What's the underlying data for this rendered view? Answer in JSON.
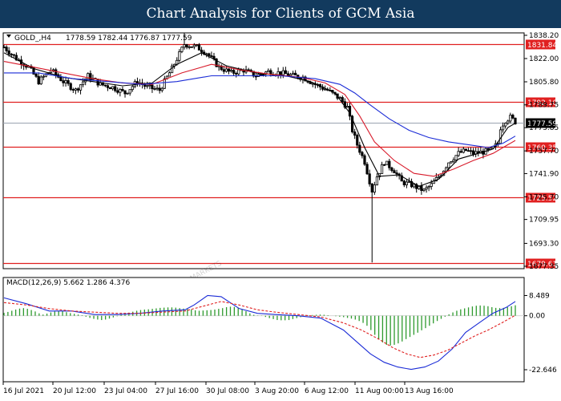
{
  "header": {
    "title": "Chart Analysis for Clients of GCM Asia"
  },
  "watermark": {
    "main": "GCMASIA",
    "sub": "GLOBAL CAPITAL MARKETS",
    "opacity": 0.18
  },
  "colors": {
    "header_bg": "#123a5e",
    "candle": "#000000",
    "ma_fast": "#000000",
    "ma_mid": "#d81b2b",
    "ma_slow": "#1a2bd6",
    "level_line": "#e02020",
    "macd_hist": "#2e9a2e",
    "macd_line": "#1a2bd6",
    "signal_line": "#e02020",
    "last_price_line": "#9aa3b0"
  },
  "chart_data": [
    {
      "type": "candlestick",
      "symbol_label": "GOLD_,H4",
      "ohlc_label": "1778.59 1782.44 1776.87 1777.59",
      "y_ticks": [
        "1838.20",
        "1822.00",
        "1805.80",
        "1789.75",
        "1773.85",
        "1757.70",
        "1741.90",
        "1725.70",
        "1709.95",
        "1693.30",
        "1677.35"
      ],
      "y_range": [
        1677.35,
        1838.2
      ],
      "x_labels": [
        "16 Jul 2021",
        "20 Jul 12:00",
        "23 Jul 04:00",
        "27 Jul 16:00",
        "30 Jul 08:00",
        "3 Aug 20:00",
        "6 Aug 12:00",
        "11 Aug 00:00",
        "13 Aug 16:00"
      ],
      "levels": [
        {
          "label": "1831.84",
          "value": 1831.84
        },
        {
          "label": "1792.10",
          "value": 1792.1
        },
        {
          "label": "1760.35",
          "value": 1760.35
        },
        {
          "label": "1725.52",
          "value": 1725.52
        },
        {
          "label": "1679.61",
          "value": 1679.61
        }
      ],
      "last_price": {
        "label": "1777.59",
        "value": 1777.59
      },
      "close_path": [
        [
          0,
          1830
        ],
        [
          5,
          1822
        ],
        [
          10,
          1816
        ],
        [
          14,
          1806
        ],
        [
          19,
          1814
        ],
        [
          24,
          1806
        ],
        [
          29,
          1800
        ],
        [
          34,
          1810
        ],
        [
          39,
          1804
        ],
        [
          44,
          1802
        ],
        [
          49,
          1798
        ],
        [
          54,
          1806
        ],
        [
          58,
          1802
        ],
        [
          63,
          1800
        ],
        [
          68,
          1815
        ],
        [
          73,
          1832
        ],
        [
          78,
          1830
        ],
        [
          82,
          1826
        ],
        [
          87,
          1816
        ],
        [
          92,
          1812
        ],
        [
          97,
          1814
        ],
        [
          102,
          1810
        ],
        [
          107,
          1813
        ],
        [
          112,
          1812
        ],
        [
          117,
          1810
        ],
        [
          121,
          1809
        ],
        [
          126,
          1804
        ],
        [
          131,
          1800
        ],
        [
          136,
          1794
        ],
        [
          139,
          1788
        ],
        [
          141,
          1772
        ],
        [
          143,
          1762
        ],
        [
          146,
          1750
        ],
        [
          149,
          1730
        ],
        [
          151,
          1740
        ],
        [
          154,
          1750
        ],
        [
          158,
          1744
        ],
        [
          161,
          1736
        ],
        [
          165,
          1734
        ],
        [
          170,
          1730
        ],
        [
          173,
          1734
        ],
        [
          177,
          1742
        ],
        [
          180,
          1750
        ],
        [
          184,
          1756
        ],
        [
          187,
          1758
        ],
        [
          190,
          1756
        ],
        [
          194,
          1757
        ],
        [
          197,
          1758
        ],
        [
          200,
          1763
        ],
        [
          201,
          1774
        ],
        [
          203,
          1779
        ],
        [
          205,
          1781
        ],
        [
          207,
          1778
        ]
      ],
      "moving_averages": [
        {
          "name": "fast",
          "color": "#000000",
          "points": [
            [
              0,
              1826
            ],
            [
              12,
              1815
            ],
            [
              24,
              1809
            ],
            [
              36,
              1806
            ],
            [
              48,
              1803
            ],
            [
              60,
              1805
            ],
            [
              70,
              1818
            ],
            [
              80,
              1826
            ],
            [
              90,
              1817
            ],
            [
              102,
              1812
            ],
            [
              114,
              1810
            ],
            [
              124,
              1806
            ],
            [
              134,
              1798
            ],
            [
              140,
              1784
            ],
            [
              146,
              1760
            ],
            [
              152,
              1740
            ],
            [
              160,
              1741
            ],
            [
              168,
              1733
            ],
            [
              176,
              1738
            ],
            [
              184,
              1752
            ],
            [
              192,
              1756
            ],
            [
              198,
              1759
            ],
            [
              204,
              1774
            ],
            [
              207,
              1777
            ]
          ]
        },
        {
          "name": "mid",
          "color": "#d81b2b",
          "points": [
            [
              0,
              1820
            ],
            [
              12,
              1816
            ],
            [
              24,
              1812
            ],
            [
              36,
              1808
            ],
            [
              48,
              1805
            ],
            [
              60,
              1804
            ],
            [
              72,
              1812
            ],
            [
              84,
              1818
            ],
            [
              96,
              1814
            ],
            [
              108,
              1811
            ],
            [
              120,
              1809
            ],
            [
              130,
              1805
            ],
            [
              138,
              1797
            ],
            [
              144,
              1782
            ],
            [
              150,
              1764
            ],
            [
              158,
              1751
            ],
            [
              166,
              1742
            ],
            [
              174,
              1740
            ],
            [
              182,
              1745
            ],
            [
              190,
              1751
            ],
            [
              198,
              1756
            ],
            [
              204,
              1762
            ],
            [
              207,
              1765
            ]
          ]
        },
        {
          "name": "slow",
          "color": "#1a2bd6",
          "points": [
            [
              0,
              1812
            ],
            [
              14,
              1812
            ],
            [
              28,
              1808
            ],
            [
              42,
              1806
            ],
            [
              56,
              1804
            ],
            [
              70,
              1806
            ],
            [
              84,
              1810
            ],
            [
              98,
              1810
            ],
            [
              112,
              1810
            ],
            [
              126,
              1808
            ],
            [
              136,
              1804
            ],
            [
              142,
              1798
            ],
            [
              148,
              1790
            ],
            [
              156,
              1780
            ],
            [
              164,
              1772
            ],
            [
              172,
              1767
            ],
            [
              180,
              1764
            ],
            [
              188,
              1762
            ],
            [
              196,
              1760
            ],
            [
              202,
              1763
            ],
            [
              207,
              1768
            ]
          ]
        }
      ]
    },
    {
      "type": "macd",
      "label": "MACD(12,26,9) 5.662 1.286 4.376",
      "y_ticks": [
        "8.489",
        "0.00",
        "-22.646"
      ],
      "y_range": [
        -25.0,
        11.0
      ],
      "histogram": [
        1.2,
        1.6,
        2.1,
        2.6,
        3.0,
        3.2,
        2.9,
        2.4,
        1.8,
        1.0,
        0.5,
        0.9,
        1.4,
        1.8,
        2.0,
        1.9,
        1.5,
        1.1,
        0.8,
        0.5,
        0.2,
        -0.4,
        -0.9,
        -1.3,
        -1.6,
        -1.8,
        -1.6,
        -1.2,
        -0.7,
        -0.2,
        0.4,
        0.9,
        1.3,
        1.7,
        2.1,
        2.4,
        2.6,
        2.7,
        2.9,
        3.1,
        3.3,
        3.4,
        3.5,
        3.5,
        3.4,
        3.2,
        3.0,
        2.8,
        2.6,
        2.3,
        2.1,
        2.2,
        2.3,
        2.4,
        2.6,
        2.9,
        3.2,
        3.6,
        3.8,
        3.7,
        3.4,
        2.8,
        1.9,
        1.0,
        0.4,
        0.1,
        -0.1,
        -0.5,
        -1.0,
        -1.4,
        -1.8,
        -1.9,
        -1.9,
        -1.8,
        -1.4,
        -1.0,
        -0.6,
        -0.3,
        0.1,
        0.3,
        0.4,
        0.5,
        0.4,
        0.2,
        0.0,
        -0.2,
        -0.4,
        -0.6,
        -0.9,
        -1.2,
        -1.6,
        -2.2,
        -3.0,
        -4.2,
        -6.0,
        -8.0,
        -9.8,
        -11.2,
        -12.2,
        -12.5,
        -12.2,
        -11.6,
        -10.8,
        -9.8,
        -8.9,
        -8.0,
        -7.1,
        -6.1,
        -5.2,
        -4.2,
        -3.2,
        -2.2,
        -1.3,
        -0.4,
        0.6,
        1.4,
        2.1,
        2.7,
        3.1,
        3.5,
        3.9,
        4.2,
        4.3,
        4.2,
        4.0,
        3.6,
        3.3,
        3.2,
        3.3,
        3.6,
        4.0,
        4.4
      ],
      "macd_path": [
        [
          0,
          7.5
        ],
        [
          10,
          5.0
        ],
        [
          20,
          2.0
        ],
        [
          30,
          2.0
        ],
        [
          40,
          0.5
        ],
        [
          50,
          0.5
        ],
        [
          60,
          1.0
        ],
        [
          70,
          2.0
        ],
        [
          80,
          2.5
        ],
        [
          84,
          4.5
        ],
        [
          90,
          8.5
        ],
        [
          96,
          8.0
        ],
        [
          104,
          3.0
        ],
        [
          112,
          1.0
        ],
        [
          120,
          0.5
        ],
        [
          130,
          0.0
        ],
        [
          140,
          -1.0
        ],
        [
          150,
          -6.0
        ],
        [
          156,
          -11.0
        ],
        [
          162,
          -16.0
        ],
        [
          168,
          -19.5
        ],
        [
          174,
          -21.5
        ],
        [
          180,
          -22.5
        ],
        [
          186,
          -21.5
        ],
        [
          192,
          -19.0
        ],
        [
          198,
          -14.0
        ],
        [
          204,
          -7.0
        ],
        [
          210,
          -3.0
        ],
        [
          216,
          1.0
        ],
        [
          222,
          3.5
        ],
        [
          226,
          6.0
        ]
      ],
      "signal_path": [
        [
          0,
          5.5
        ],
        [
          10,
          4.5
        ],
        [
          20,
          3.0
        ],
        [
          30,
          2.0
        ],
        [
          40,
          1.5
        ],
        [
          50,
          1.0
        ],
        [
          60,
          1.0
        ],
        [
          70,
          1.5
        ],
        [
          80,
          2.0
        ],
        [
          88,
          4.0
        ],
        [
          96,
          6.0
        ],
        [
          104,
          4.5
        ],
        [
          112,
          2.5
        ],
        [
          120,
          1.5
        ],
        [
          130,
          0.5
        ],
        [
          140,
          -0.5
        ],
        [
          150,
          -3.0
        ],
        [
          158,
          -6.0
        ],
        [
          166,
          -10.0
        ],
        [
          172,
          -13.5
        ],
        [
          178,
          -16.0
        ],
        [
          184,
          -17.5
        ],
        [
          190,
          -16.5
        ],
        [
          196,
          -14.5
        ],
        [
          202,
          -11.5
        ],
        [
          208,
          -8.5
        ],
        [
          214,
          -6.0
        ],
        [
          220,
          -3.0
        ],
        [
          226,
          0.2
        ]
      ]
    }
  ]
}
